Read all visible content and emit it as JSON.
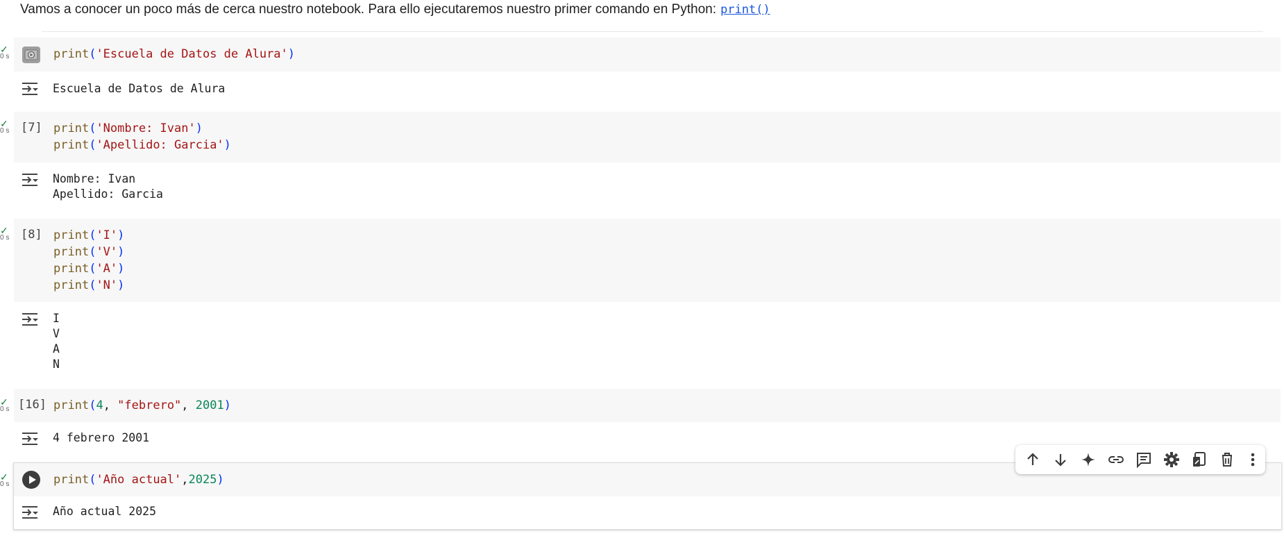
{
  "intro": {
    "text": "Vamos a conocer un poco más de cerca nuestro notebook. Para ello ejecutaremos nuestro primer comando en Python:",
    "link": "print()"
  },
  "status": {
    "check": "✓",
    "time": "0 s"
  },
  "cells": [
    {
      "exec_count": "",
      "code": [
        [
          {
            "t": "print",
            "c": "kw"
          },
          {
            "t": "(",
            "c": "par"
          },
          {
            "t": "'Escuela de Datos de Alura'",
            "c": "str"
          },
          {
            "t": ")",
            "c": "par"
          }
        ]
      ],
      "output": [
        "Escuela de Datos de Alura"
      ]
    },
    {
      "exec_count": "[7]",
      "code": [
        [
          {
            "t": "print",
            "c": "kw"
          },
          {
            "t": "(",
            "c": "par"
          },
          {
            "t": "'Nombre: Ivan'",
            "c": "str"
          },
          {
            "t": ")",
            "c": "par"
          }
        ],
        [
          {
            "t": "print",
            "c": "kw"
          },
          {
            "t": "(",
            "c": "par"
          },
          {
            "t": "'Apellido: Garcia'",
            "c": "str"
          },
          {
            "t": ")",
            "c": "par"
          }
        ]
      ],
      "output": [
        "Nombre: Ivan",
        "Apellido: Garcia"
      ]
    },
    {
      "exec_count": "[8]",
      "code": [
        [
          {
            "t": "print",
            "c": "kw"
          },
          {
            "t": "(",
            "c": "par"
          },
          {
            "t": "'I'",
            "c": "str"
          },
          {
            "t": ")",
            "c": "par"
          }
        ],
        [
          {
            "t": "print",
            "c": "kw"
          },
          {
            "t": "(",
            "c": "par"
          },
          {
            "t": "'V'",
            "c": "str"
          },
          {
            "t": ")",
            "c": "par"
          }
        ],
        [
          {
            "t": "print",
            "c": "kw"
          },
          {
            "t": "(",
            "c": "par"
          },
          {
            "t": "'A'",
            "c": "str"
          },
          {
            "t": ")",
            "c": "par"
          }
        ],
        [
          {
            "t": "print",
            "c": "kw"
          },
          {
            "t": "(",
            "c": "par"
          },
          {
            "t": "'N'",
            "c": "str"
          },
          {
            "t": ")",
            "c": "par"
          }
        ]
      ],
      "output": [
        "I",
        "V",
        "A",
        "N"
      ]
    },
    {
      "exec_count": "[16]",
      "code": [
        [
          {
            "t": "print",
            "c": "kw"
          },
          {
            "t": "(",
            "c": "par"
          },
          {
            "t": "4",
            "c": "num"
          },
          {
            "t": ", ",
            "c": "pun"
          },
          {
            "t": "\"febrero\"",
            "c": "str"
          },
          {
            "t": ", ",
            "c": "pun"
          },
          {
            "t": "2001",
            "c": "num"
          },
          {
            "t": ")",
            "c": "par"
          }
        ]
      ],
      "output": [
        "4 febrero 2001"
      ]
    },
    {
      "exec_count": "",
      "code": [
        [
          {
            "t": "print",
            "c": "kw"
          },
          {
            "t": "(",
            "c": "par"
          },
          {
            "t": "'Año actual'",
            "c": "str"
          },
          {
            "t": ",",
            "c": "pun"
          },
          {
            "t": "2025",
            "c": "num"
          },
          {
            "t": ")",
            "c": "par"
          }
        ]
      ],
      "output": [
        "Año actual 2025"
      ]
    }
  ],
  "toolbar": [
    "arrow-up-icon",
    "arrow-down-icon",
    "gemini-sparkle-icon",
    "link-icon",
    "comment-icon",
    "gear-icon",
    "mirror-cell-icon",
    "trash-icon",
    "more-vert-icon"
  ],
  "colors": {
    "cell_bg": "#f7f7f7",
    "check": "#188038",
    "keyword": "#795e26",
    "string": "#a31515",
    "number": "#098658",
    "paren": "#0431fa"
  }
}
